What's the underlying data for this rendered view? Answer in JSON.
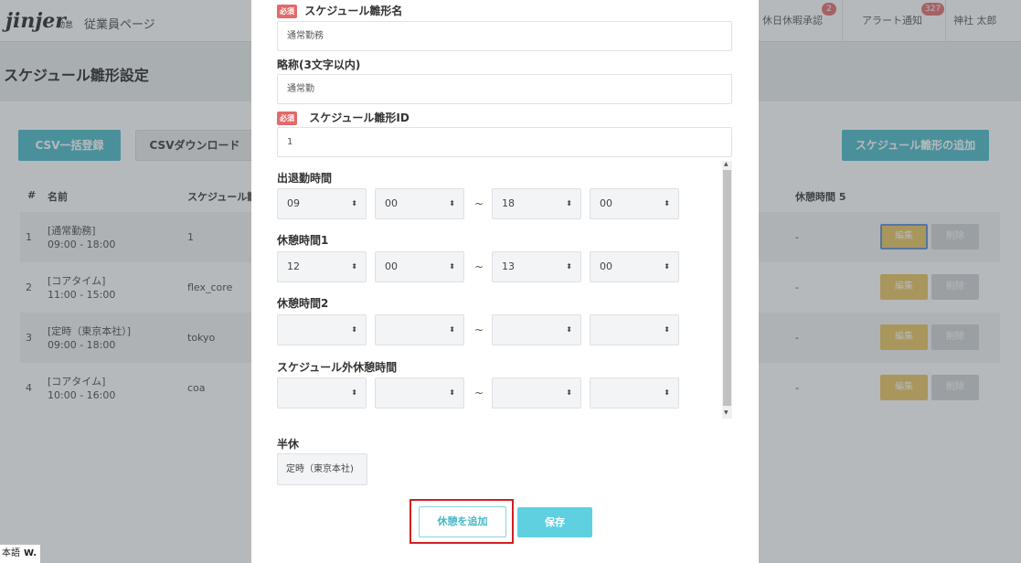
{
  "header": {
    "logo": "jinjer",
    "logo_sub": "勤怠",
    "page_label": "従業員ページ",
    "items": [
      {
        "label": "休日休暇承認",
        "badge": "2"
      },
      {
        "label": "アラート通知",
        "badge": "327"
      },
      {
        "label": "神社 太郎",
        "badge": ""
      }
    ]
  },
  "page": {
    "title": "スケジュール雛形設定",
    "csv_import": "CSV一括登録",
    "csv_download": "CSVダウンロード",
    "add_template": "スケジュール雛形の追加"
  },
  "table": {
    "headers": {
      "num": "#",
      "name": "名前",
      "template": "スケジュール雛",
      "break5": "休憩時間 5"
    },
    "rows": [
      {
        "num": "1",
        "name": "[通常勤務]",
        "time": "09:00 - 18:00",
        "id": "1",
        "break5": "-",
        "edit": "編集",
        "del": "削除"
      },
      {
        "num": "2",
        "name": "[コアタイム]",
        "time": "11:00 - 15:00",
        "id": "flex_core",
        "break5": "-",
        "edit": "編集",
        "del": "削除"
      },
      {
        "num": "3",
        "name": "[定時（東京本社）]",
        "time": "09:00 - 18:00",
        "id": "tokyo",
        "break5": "-",
        "edit": "編集",
        "del": "削除"
      },
      {
        "num": "4",
        "name": "[コアタイム]",
        "time": "10:00 - 16:00",
        "id": "coa",
        "break5": "-",
        "edit": "編集",
        "del": "削除"
      }
    ]
  },
  "modal": {
    "required": "必須",
    "name_label": "スケジュール雛形名",
    "name_value": "通常勤務",
    "abbr_label": "略称(3文字以内)",
    "abbr_value": "通常勤",
    "id_label": "スケジュール雛形ID",
    "id_value": "1",
    "work_label": "出退勤時間",
    "work": [
      "09",
      "00",
      "18",
      "00"
    ],
    "break1_label": "休憩時間1",
    "break1": [
      "12",
      "00",
      "13",
      "00"
    ],
    "break2_label": "休憩時間2",
    "break2": [
      "",
      "",
      "",
      ""
    ],
    "outside_label": "スケジュール外休憩時間",
    "outside": [
      "",
      "",
      "",
      ""
    ],
    "tilde": "~",
    "half_label": "半休",
    "half_value": "定時（東京本社)",
    "add_break": "休憩を追加",
    "save": "保存"
  },
  "lang": {
    "text": "本語",
    "w": "W."
  }
}
